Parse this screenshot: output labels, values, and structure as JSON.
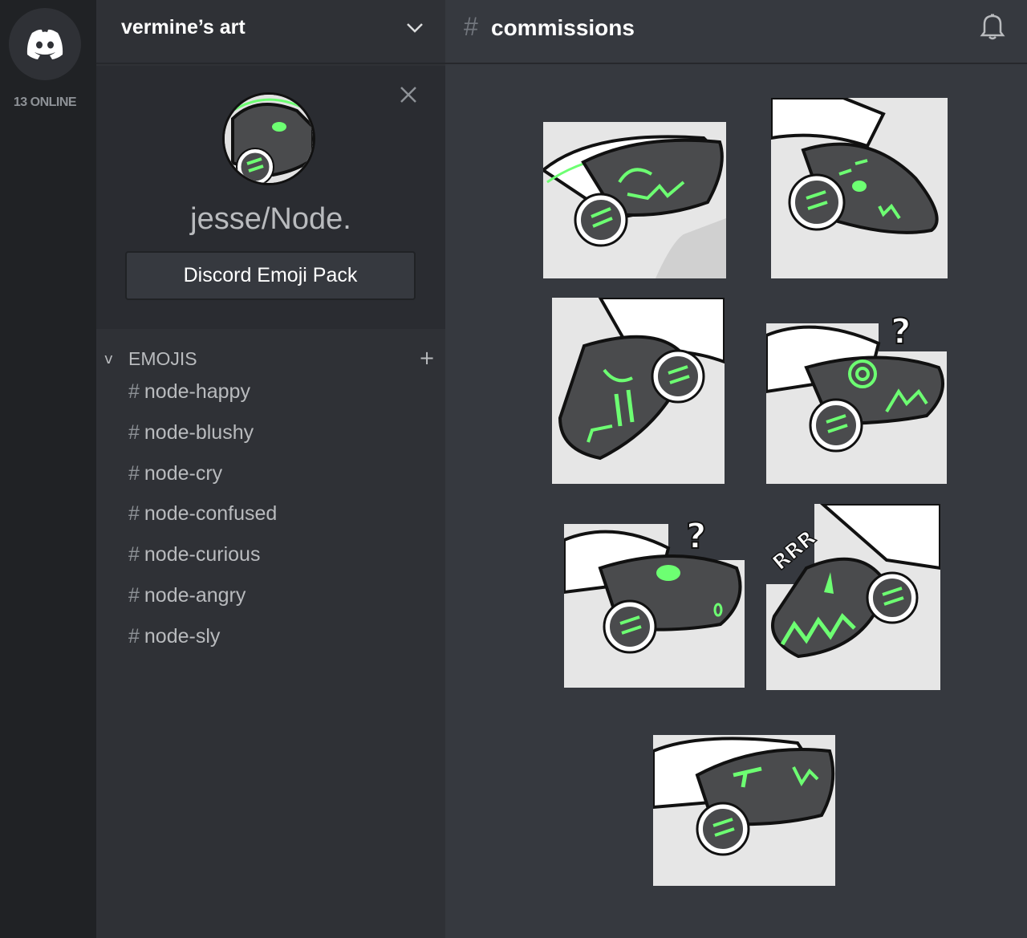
{
  "rail": {
    "online_label": "13 ONLINE",
    "logo_icon": "discord-logo-icon"
  },
  "server": {
    "name": "vermine’s art"
  },
  "profile": {
    "username": "jesse/Node.",
    "button_label": "Discord Emoji Pack"
  },
  "category": {
    "arrow": "v",
    "label": "EMOJIS",
    "add": "+"
  },
  "channels": [
    {
      "hash": "#",
      "name": "node-happy"
    },
    {
      "hash": "#",
      "name": "node-blushy"
    },
    {
      "hash": "#",
      "name": "node-cry"
    },
    {
      "hash": "#",
      "name": "node-confused"
    },
    {
      "hash": "#",
      "name": "node-curious"
    },
    {
      "hash": "#",
      "name": "node-angry"
    },
    {
      "hash": "#",
      "name": "node-sly"
    }
  ],
  "topbar": {
    "hash": "#",
    "title": "commissions"
  },
  "emojis": [
    {
      "name": "happy"
    },
    {
      "name": "blushy"
    },
    {
      "name": "cry"
    },
    {
      "name": "confused",
      "mark": "?"
    },
    {
      "name": "curious",
      "mark": "?"
    },
    {
      "name": "angry",
      "mark": "RRR"
    },
    {
      "name": "sly"
    }
  ],
  "colors": {
    "accent_green": "#6dff72",
    "visor": "#4a4b4d",
    "bg_main": "#36393f",
    "bg_sidebar": "#2f3136",
    "bg_rail": "#202225"
  }
}
